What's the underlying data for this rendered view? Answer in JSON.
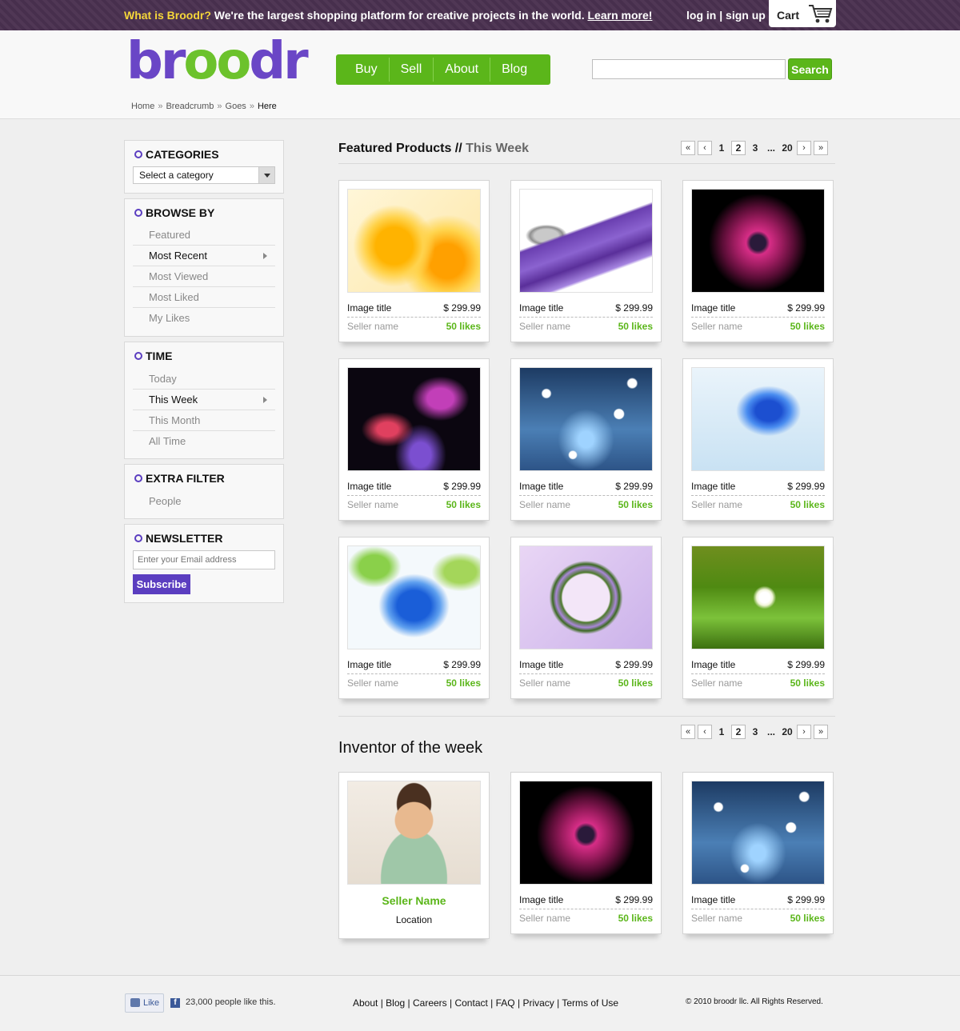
{
  "topbar": {
    "promo_highlight": "What is Broodr?",
    "promo_text": " We're the largest shopping platform for creative projects in the world. ",
    "learn_more": "Learn more!",
    "login": "log in",
    "separator": " | ",
    "signup": "sign up",
    "cart_label": "Cart",
    "cart_icon": "cart-icon"
  },
  "header": {
    "logo_text_1": "br",
    "logo_text_oo": "oo",
    "logo_text_2": "dr",
    "nav": [
      "Buy",
      "Sell",
      "About",
      "Blog"
    ],
    "search_placeholder": "",
    "search_button": "Search",
    "breadcrumb": [
      "Home",
      "Breadcrumb",
      "Goes",
      "Here"
    ],
    "breadcrumb_sep": "»"
  },
  "sidebar": {
    "categories": {
      "title": "CATEGORIES",
      "select_value": "Select a category"
    },
    "browse": {
      "title": "BROWSE BY",
      "items": [
        "Featured",
        "Most Recent",
        "Most Viewed",
        "Most Liked",
        "My Likes"
      ],
      "active": "Most Recent"
    },
    "time": {
      "title": "TIME",
      "items": [
        "Today",
        "This Week",
        "This Month",
        "All Time"
      ],
      "active": "This Week"
    },
    "extra": {
      "title": "EXTRA FILTER",
      "items": [
        "People"
      ]
    },
    "newsletter": {
      "title": "NEWSLETTER",
      "email_placeholder": "Enter your Email address",
      "subscribe": "Subscribe"
    }
  },
  "featured": {
    "title": "Featured Products",
    "sep": " // ",
    "subtitle": "This Week",
    "pager": {
      "first": "«",
      "prev": "‹",
      "pages": [
        "1",
        "2",
        "3"
      ],
      "current": "2",
      "ellipsis": "...",
      "last_page": "20",
      "next": "›",
      "last": "»"
    },
    "cards": [
      {
        "title": "Image title",
        "price": "$ 299.99",
        "seller": "Seller name",
        "likes": "50 likes",
        "image": "yellow-flowers"
      },
      {
        "title": "Image title",
        "price": "$ 299.99",
        "seller": "Seller name",
        "likes": "50 likes",
        "image": "key-purple-zippers"
      },
      {
        "title": "Image title",
        "price": "$ 299.99",
        "seller": "Seller name",
        "likes": "50 likes",
        "image": "magenta-daisy"
      },
      {
        "title": "Image title",
        "price": "$ 299.99",
        "seller": "Seller name",
        "likes": "50 likes",
        "image": "neon-lilies"
      },
      {
        "title": "Image title",
        "price": "$ 299.99",
        "seller": "Seller name",
        "likes": "50 likes",
        "image": "blue-bokeh"
      },
      {
        "title": "Image title",
        "price": "$ 299.99",
        "seller": "Seller name",
        "likes": "50 likes",
        "image": "blue-water-splash"
      },
      {
        "title": "Image title",
        "price": "$ 299.99",
        "seller": "Seller name",
        "likes": "50 likes",
        "image": "blue-leaf-glass"
      },
      {
        "title": "Image title",
        "price": "$ 299.99",
        "seller": "Seller name",
        "likes": "50 likes",
        "image": "flower-wreath"
      },
      {
        "title": "Image title",
        "price": "$ 299.99",
        "seller": "Seller name",
        "likes": "50 likes",
        "image": "white-flower-grass"
      }
    ]
  },
  "inventor": {
    "title": "Inventor of the week",
    "person": {
      "name": "Seller Name",
      "location": "Location",
      "image": "smiling-man"
    },
    "cards": [
      {
        "title": "Image title",
        "price": "$ 299.99",
        "seller": "Seller name",
        "likes": "50 likes",
        "image": "magenta-daisy"
      },
      {
        "title": "Image title",
        "price": "$ 299.99",
        "seller": "Seller name",
        "likes": "50 likes",
        "image": "blue-bokeh"
      }
    ]
  },
  "footer": {
    "like": "Like",
    "fb_icon": "facebook-icon",
    "fb_text": "23,000 people like this.",
    "links": [
      "About",
      "Blog",
      "Careers",
      "Contact",
      "FAQ",
      "Privacy",
      "Terms of Use"
    ],
    "link_sep": " | ",
    "copyright": "© 2010 broodr llc. All Rights Reserved."
  },
  "colors": {
    "brand_purple": "#5b3ec0",
    "brand_green": "#5bb61a",
    "topbar": "#4a3150",
    "promo_yellow": "#f5d63a"
  }
}
